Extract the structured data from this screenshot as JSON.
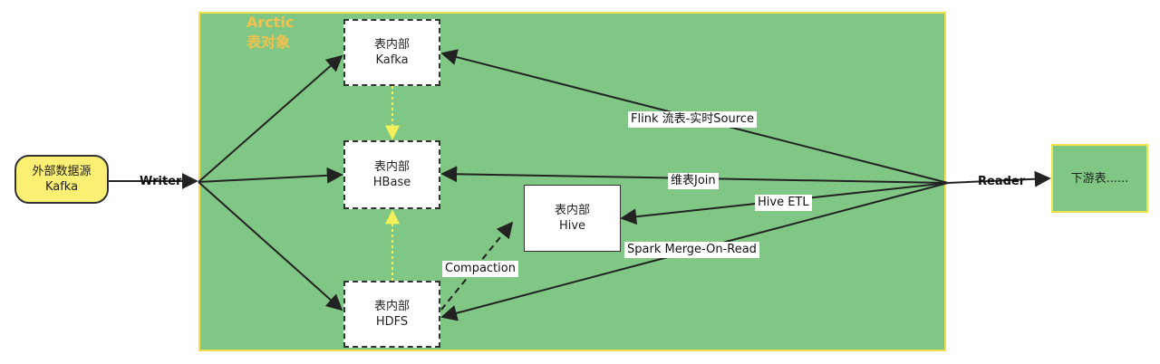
{
  "container": {
    "title_line1": "Arctic",
    "title_line2": "表对象"
  },
  "nodes": {
    "external": {
      "line1": "外部数据源",
      "line2": "Kafka"
    },
    "kafka": {
      "line1": "表内部",
      "line2": "Kafka"
    },
    "hbase": {
      "line1": "表内部",
      "line2": "HBase"
    },
    "hdfs": {
      "line1": "表内部",
      "line2": "HDFS"
    },
    "hive": {
      "line1": "表内部",
      "line2": "Hive"
    },
    "downstream": {
      "label": "下游表......"
    }
  },
  "edges": {
    "writer": "Writer",
    "reader": "Reader",
    "flink": "Flink 流表-实时Source",
    "dim_join": "维表Join",
    "hive_etl": "Hive ETL",
    "spark": "Spark Merge-On-Read",
    "compaction": "Compaction"
  },
  "colors": {
    "container_fill": "#80c785",
    "border_yellow": "#f2e04b",
    "title_orange": "#f2c14e",
    "external_fill": "#fbef74"
  }
}
